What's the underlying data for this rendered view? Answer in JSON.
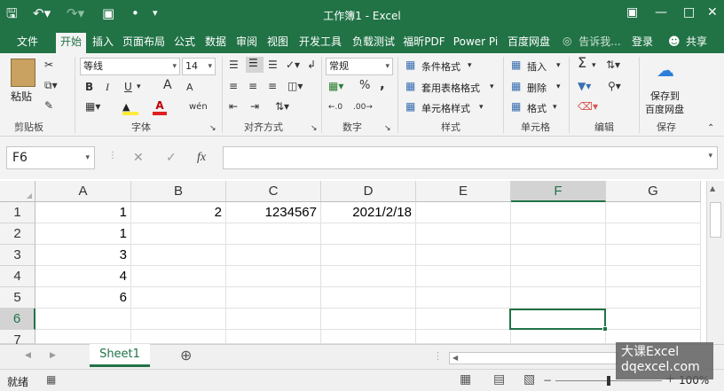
{
  "window": {
    "title": "工作簿1 - Excel"
  },
  "ribbon_tabs": [
    "文件",
    "开始",
    "插入",
    "页面布局",
    "公式",
    "数据",
    "审阅",
    "视图",
    "开发工具",
    "负载测试",
    "福昕PDF",
    "Power Pi",
    "百度网盘"
  ],
  "active_tab": "开始",
  "tell_me": "告诉我...",
  "login": "登录",
  "share": "共享",
  "clipboard": {
    "paste": "粘贴",
    "label": "剪贴板"
  },
  "font": {
    "name": "等线",
    "size": "14",
    "bold": "B",
    "italic": "I",
    "underline": "U",
    "grow": "A",
    "shrink": "A",
    "wen": "wén",
    "label": "字体"
  },
  "alignment": {
    "label": "对齐方式"
  },
  "number": {
    "format": "常规",
    "percent": "%",
    "comma": ",",
    "label": "数字"
  },
  "styles": {
    "conditional": "条件格式",
    "table": "套用表格格式",
    "cell": "单元格样式",
    "label": "样式"
  },
  "cells": {
    "insert": "插入",
    "delete": "删除",
    "format": "格式",
    "label": "单元格"
  },
  "editing": {
    "label": "编辑"
  },
  "save": {
    "line1": "保存到",
    "line2": "百度网盘",
    "label": "保存"
  },
  "namebox": "F6",
  "fx": "fx",
  "columns": [
    "A",
    "B",
    "C",
    "D",
    "E",
    "F",
    "G"
  ],
  "selected_column": "F",
  "rows": [
    "1",
    "2",
    "3",
    "4",
    "5",
    "6",
    "7"
  ],
  "selected_row": "6",
  "cells_data": [
    [
      "1",
      "2",
      "1234567",
      "2021/2/18",
      "",
      "",
      ""
    ],
    [
      "1",
      "",
      "",
      "",
      "",
      "",
      ""
    ],
    [
      "3",
      "",
      "",
      "",
      "",
      "",
      ""
    ],
    [
      "4",
      "",
      "",
      "",
      "",
      "",
      ""
    ],
    [
      "6",
      "",
      "",
      "",
      "",
      "",
      ""
    ],
    [
      "",
      "",
      "",
      "",
      "",
      "",
      ""
    ],
    [
      "",
      "",
      "",
      "",
      "",
      "",
      ""
    ]
  ],
  "sheet_tab": "Sheet1",
  "status": "就绪",
  "zoom": "100%",
  "watermark": {
    "line1": "大课Excel",
    "line2": "dqexcel.com"
  }
}
